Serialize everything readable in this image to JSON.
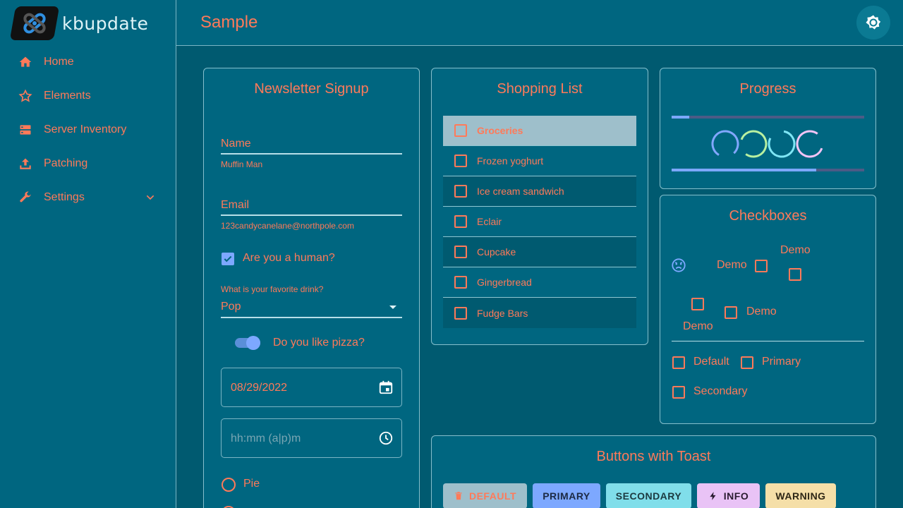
{
  "sidebar": {
    "brand": "kbupdate",
    "items": [
      {
        "label": "Home",
        "icon": "home-icon"
      },
      {
        "label": "Elements",
        "icon": "star-icon"
      },
      {
        "label": "Server Inventory",
        "icon": "server-icon"
      },
      {
        "label": "Patching",
        "icon": "upload-icon"
      },
      {
        "label": "Settings",
        "icon": "wrench-icon"
      }
    ]
  },
  "header": {
    "title": "Sample"
  },
  "newsletter": {
    "title": "Newsletter Signup",
    "name_label": "Name",
    "name_value": "Muffin Man",
    "email_label": "Email",
    "email_value": "123candycanelane@northpole.com",
    "human_label": "Are you a human?",
    "human_checked": true,
    "drink_label": "What is your favorite drink?",
    "drink_value": "Pop",
    "pizza_label": "Do you like pizza?",
    "pizza_on": true,
    "date_value": "08/29/2022",
    "time_placeholder": "hh:mm (a|p)m",
    "radio_first": "Pie"
  },
  "shopping": {
    "title": "Shopping List",
    "items": [
      "Groceries",
      "Frozen yoghurt",
      "Ice cream sandwich",
      "Eclair",
      "Cupcake",
      "Gingerbread",
      "Fudge Bars"
    ]
  },
  "progress": {
    "title": "Progress",
    "top_fraction": 0.09,
    "bottom_fraction": 0.75
  },
  "checkboxes": {
    "title": "Checkboxes",
    "demo1": "Demo",
    "demo2": "Demo",
    "demo3": "Demo",
    "demo4": "Demo",
    "default_label": "Default",
    "primary_label": "Primary",
    "secondary_label": "Secondary"
  },
  "buttons": {
    "title": "Buttons with Toast",
    "default_label": "DEFAULT",
    "primary_label": "PRIMARY",
    "secondary_label": "SECONDARY",
    "info_label": "INFO",
    "warning_label": "WARNING"
  },
  "colors": {
    "accent": "#ff7a59",
    "primary": "#7da8ff",
    "secondary": "#80deea"
  }
}
